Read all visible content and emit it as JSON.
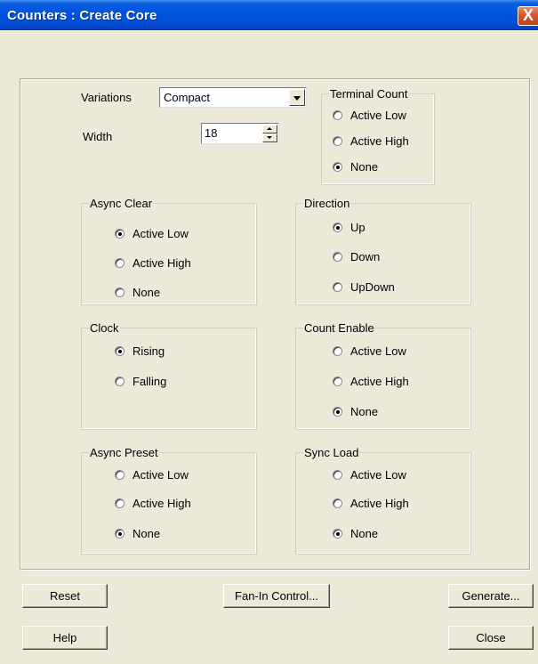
{
  "window": {
    "title": "Counters : Create Core",
    "close_glyph": "X"
  },
  "form": {
    "variations_label": "Variations",
    "variations_value": "Compact",
    "width_label": "Width",
    "width_value": "18"
  },
  "groups": {
    "terminal_count": {
      "legend": "Terminal Count",
      "options": [
        "Active Low",
        "Active High",
        "None"
      ],
      "selected": 2
    },
    "async_clear": {
      "legend": "Async Clear",
      "options": [
        "Active Low",
        "Active High",
        "None"
      ],
      "selected": 0
    },
    "direction": {
      "legend": "Direction",
      "options": [
        "Up",
        "Down",
        "UpDown"
      ],
      "selected": 0
    },
    "clock": {
      "legend": "Clock",
      "options": [
        "Rising",
        "Falling"
      ],
      "selected": 0
    },
    "count_enable": {
      "legend": "Count Enable",
      "options": [
        "Active Low",
        "Active High",
        "None"
      ],
      "selected": 2
    },
    "async_preset": {
      "legend": "Async Preset",
      "options": [
        "Active Low",
        "Active High",
        "None"
      ],
      "selected": 2
    },
    "sync_load": {
      "legend": "Sync Load",
      "options": [
        "Active Low",
        "Active High",
        "None"
      ],
      "selected": 2
    }
  },
  "buttons": {
    "reset": "Reset",
    "fanin": "Fan-In Control...",
    "generate": "Generate...",
    "help": "Help",
    "close": "Close"
  }
}
